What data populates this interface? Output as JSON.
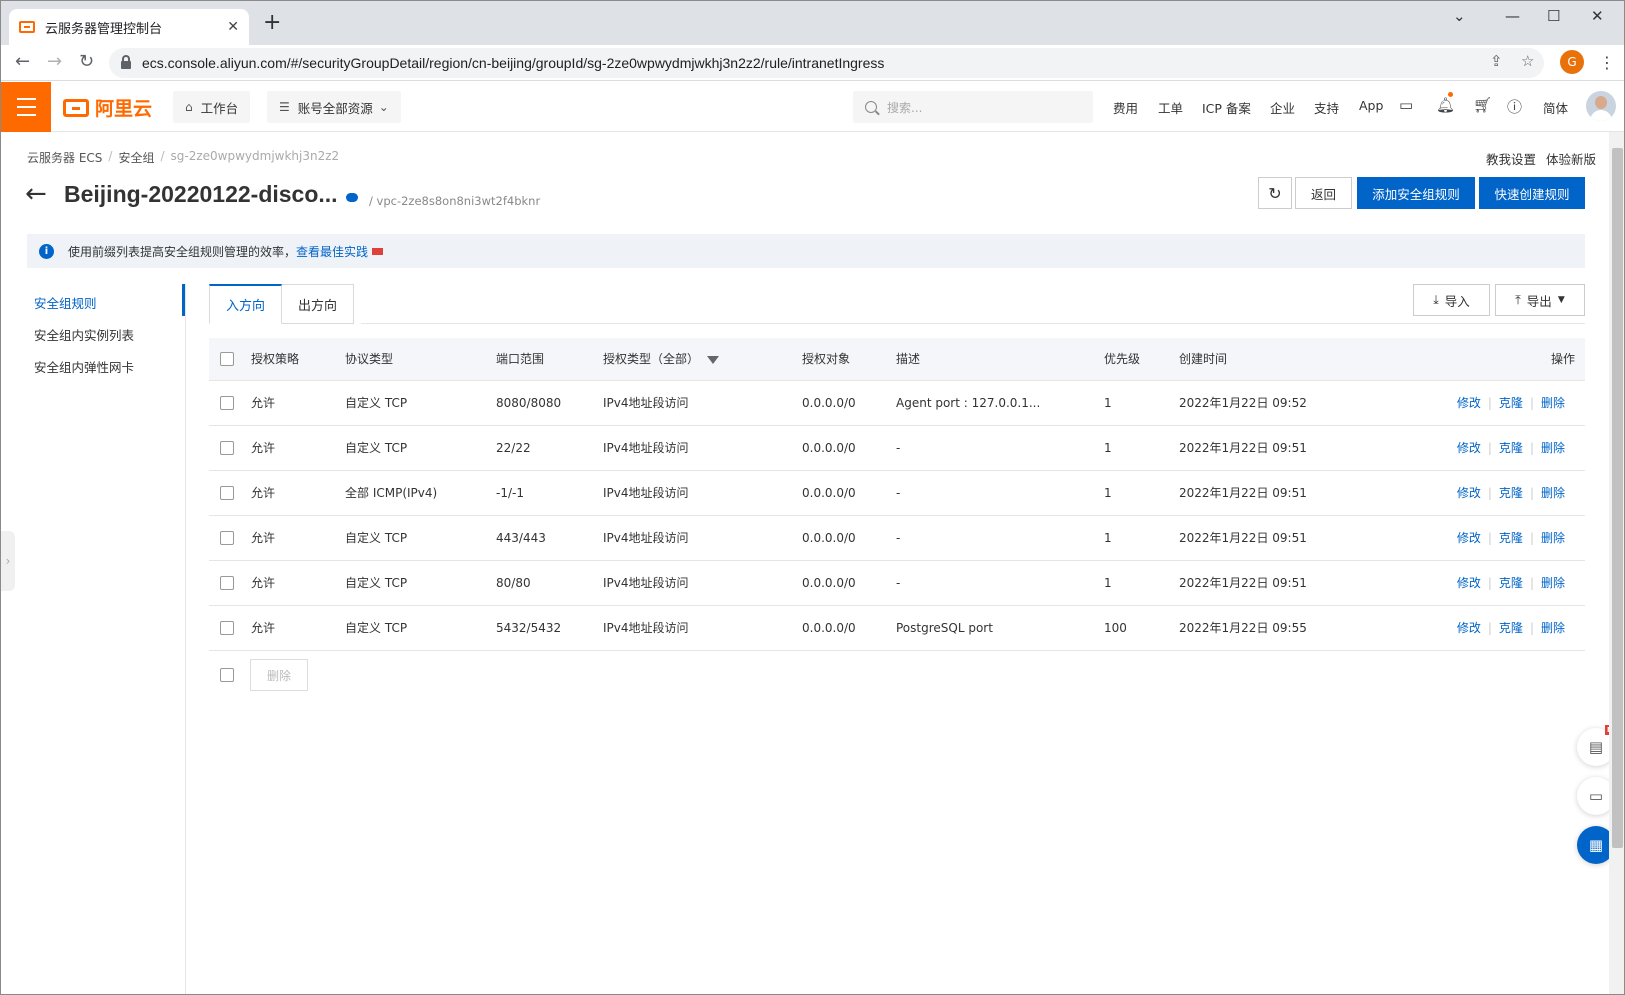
{
  "browser": {
    "tab_title": "云服务器管理控制台",
    "url": "ecs.console.aliyun.com/#/securityGroupDetail/region/cn-beijing/groupId/sg-2ze0wpwydmjwkhj3n2z2/rule/intranetIngress",
    "profile_initial": "G"
  },
  "header": {
    "logo_text": "阿里云",
    "workbench": "工作台",
    "resources": "账号全部资源",
    "search_placeholder": "搜索...",
    "links": [
      "费用",
      "工单",
      "ICP 备案",
      "企业",
      "支持",
      "App"
    ],
    "lang": "简体",
    "accent_color": "#ff6a00"
  },
  "breadcrumb": [
    "云服务器 ECS",
    "安全组",
    "sg-2ze0wpwydmjwkhj3n2z2"
  ],
  "top_links": [
    "教我设置",
    "体验新版"
  ],
  "page": {
    "title": "Beijing-20220122-disco...",
    "vpc": "/ vpc-2ze8s8on8ni3wt2f4bknr",
    "back_button": "返回",
    "add_rule_button": "添加安全组规则",
    "quick_rule_button": "快速创建规则"
  },
  "notice": {
    "text": "使用前缀列表提高安全组规则管理的效率，",
    "link": "查看最佳实践"
  },
  "sidenav": [
    "安全组规则",
    "安全组内实例列表",
    "安全组内弹性网卡"
  ],
  "tabs": [
    "入方向",
    "出方向"
  ],
  "toolbar": {
    "import": "导入",
    "export": "导出"
  },
  "table": {
    "columns": [
      "授权策略",
      "协议类型",
      "端口范围",
      "授权类型（全部）",
      "授权对象",
      "描述",
      "优先级",
      "创建时间",
      "操作"
    ],
    "rows": [
      [
        "允许",
        "自定义 TCP",
        "8080/8080",
        "IPv4地址段访问",
        "0.0.0.0/0",
        "Agent port : 127.0.0.1...",
        "1",
        "2022年1月22日 09:52"
      ],
      [
        "允许",
        "自定义 TCP",
        "22/22",
        "IPv4地址段访问",
        "0.0.0.0/0",
        "-",
        "1",
        "2022年1月22日 09:51"
      ],
      [
        "允许",
        "全部 ICMP(IPv4)",
        "-1/-1",
        "IPv4地址段访问",
        "0.0.0.0/0",
        "-",
        "1",
        "2022年1月22日 09:51"
      ],
      [
        "允许",
        "自定义 TCP",
        "443/443",
        "IPv4地址段访问",
        "0.0.0.0/0",
        "-",
        "1",
        "2022年1月22日 09:51"
      ],
      [
        "允许",
        "自定义 TCP",
        "80/80",
        "IPv4地址段访问",
        "0.0.0.0/0",
        "-",
        "1",
        "2022年1月22日 09:51"
      ],
      [
        "允许",
        "自定义 TCP",
        "5432/5432",
        "IPv4地址段访问",
        "0.0.0.0/0",
        "PostgreSQL port",
        "100",
        "2022年1月22日 09:55"
      ]
    ],
    "actions": [
      "修改",
      "克隆",
      "删除"
    ],
    "bulk_delete": "删除"
  },
  "float": {
    "new_badge": "NEW"
  }
}
